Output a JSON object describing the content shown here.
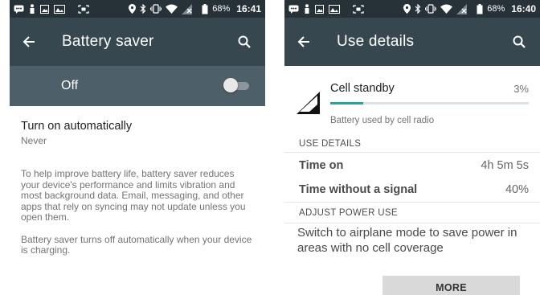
{
  "status_bar": {
    "left": {
      "battery_percent": "68%",
      "time": "16:41"
    },
    "right": {
      "battery_percent": "68%",
      "time": "16:40"
    }
  },
  "battery_saver": {
    "title": "Battery saver",
    "switch_label": "Off",
    "switch_on": false,
    "auto_title": "Turn on automatically",
    "auto_summary": "Never",
    "description_1": "To help improve battery life, battery saver reduces your device's performance and limits vibration and most background data. Email, messaging, and other apps that rely on syncing may not update unless you open them.",
    "description_2": "Battery saver turns off automatically when your device is charging."
  },
  "use_details": {
    "title": "Use details",
    "item_name": "Cell standby",
    "item_percent": "3%",
    "item_usage_fraction": 0.03,
    "item_subtitle": "Battery used by cell radio",
    "section_use_details": "USE DETAILS",
    "rows": [
      {
        "label": "Time on",
        "value": "4h 5m 5s"
      },
      {
        "label": "Time without a signal",
        "value": "40%"
      }
    ],
    "section_adjust": "ADJUST POWER USE",
    "advice": "Switch to airplane mode to save power in areas with no cell coverage",
    "more_label": "MORE"
  },
  "colors": {
    "status_bar": "#263238",
    "app_bar": "#37474f",
    "switch_bar": "#4d5f68",
    "accent": "#26a69a"
  },
  "icons": [
    "back-arrow-icon",
    "search-icon",
    "cell-signal-icon",
    "battery-icon",
    "wifi-icon",
    "bluetooth-icon",
    "location-icon",
    "vibrate-icon",
    "no-sim-icon"
  ]
}
